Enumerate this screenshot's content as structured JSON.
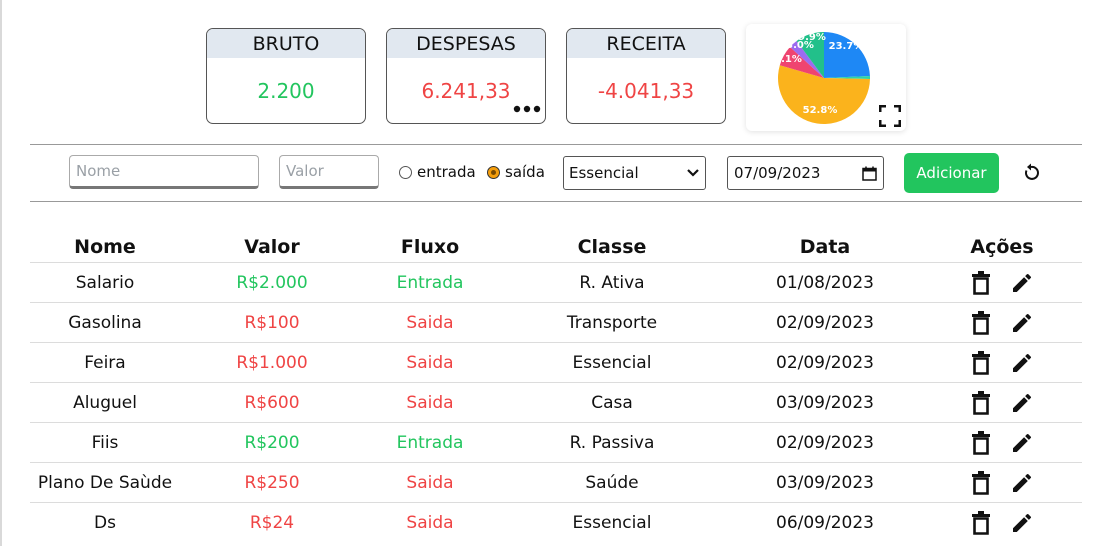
{
  "summary": {
    "bruto": {
      "label": "BRUTO",
      "value": "2.200"
    },
    "despesas": {
      "label": "DESPESAS",
      "value": "6.241,33"
    },
    "receita": {
      "label": "RECEITA",
      "value": "-4.041,33"
    }
  },
  "pie": {
    "labels": [
      "23.7%",
      "52.8%",
      "7.1%",
      "3.0%",
      "9.9%"
    ],
    "slices": [
      {
        "value": 23.7,
        "color": "#1e88f5"
      },
      {
        "value": 1.0,
        "color": "#2dd4a8"
      },
      {
        "value": 52.8,
        "color": "#fbb31c"
      },
      {
        "value": 7.1,
        "color": "#ef4470"
      },
      {
        "value": 3.0,
        "color": "#9b6cf0"
      },
      {
        "value": 9.9,
        "color": "#22c08a"
      }
    ]
  },
  "form": {
    "name_placeholder": "Nome",
    "value_placeholder": "Valor",
    "radio_entrada": "entrada",
    "radio_saida": "saída",
    "selected_class": "Essencial",
    "date": "07/09/2023",
    "add_label": "Adicionar"
  },
  "table": {
    "headers": {
      "nome": "Nome",
      "valor": "Valor",
      "fluxo": "Fluxo",
      "classe": "Classe",
      "data": "Data",
      "acoes": "Ações"
    },
    "rows": [
      {
        "nome": "Salario",
        "valor": "R$2.000",
        "fluxo": "Entrada",
        "classe": "R. Ativa",
        "data": "01/08/2023"
      },
      {
        "nome": "Gasolina",
        "valor": "R$100",
        "fluxo": "Saida",
        "classe": "Transporte",
        "data": "02/09/2023"
      },
      {
        "nome": "Feira",
        "valor": "R$1.000",
        "fluxo": "Saida",
        "classe": "Essencial",
        "data": "02/09/2023"
      },
      {
        "nome": "Aluguel",
        "valor": "R$600",
        "fluxo": "Saida",
        "classe": "Casa",
        "data": "03/09/2023"
      },
      {
        "nome": "Fiis",
        "valor": "R$200",
        "fluxo": "Entrada",
        "classe": "R. Passiva",
        "data": "02/09/2023"
      },
      {
        "nome": "Plano De Saùde",
        "valor": "R$250",
        "fluxo": "Saida",
        "classe": "Saúde",
        "data": "03/09/2023"
      },
      {
        "nome": "Ds",
        "valor": "R$24",
        "fluxo": "Saida",
        "classe": "Essencial",
        "data": "06/09/2023"
      }
    ]
  },
  "colors": {
    "entrada": "#22c55e",
    "saida": "#ef4444",
    "accent": "#22c55e"
  },
  "icons": {
    "delete": "trash-icon",
    "edit": "pencil-icon",
    "expand": "fullscreen-icon",
    "reset": "refresh-icon",
    "more": "more-dots-icon"
  }
}
